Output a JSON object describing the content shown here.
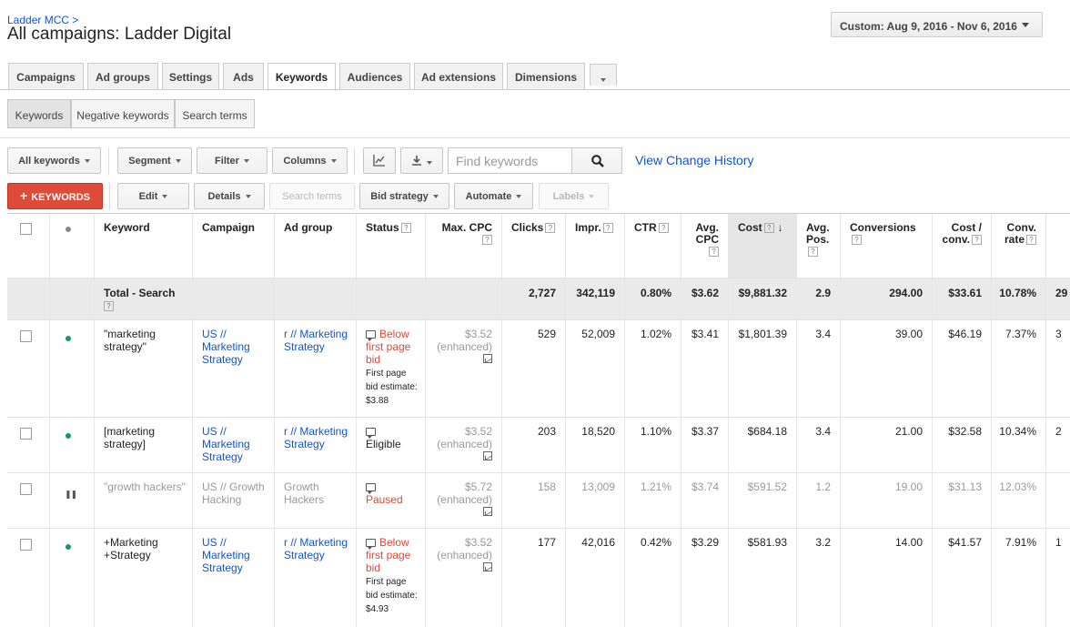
{
  "breadcrumb": "Ladder MCC >",
  "title": "All campaigns: Ladder Digital",
  "date_range": "Custom: Aug 9, 2016 - Nov 6, 2016",
  "tabs": [
    "Campaigns",
    "Ad groups",
    "Settings",
    "Ads",
    "Keywords",
    "Audiences",
    "Ad extensions",
    "Dimensions"
  ],
  "subtabs": [
    "Keywords",
    "Negative keywords",
    "Search terms"
  ],
  "toolbar": {
    "all_keywords": "All keywords",
    "segment": "Segment",
    "filter": "Filter",
    "columns": "Columns",
    "search_placeholder": "Find keywords",
    "change_history": "View Change History",
    "add_keywords": "KEYWORDS",
    "edit": "Edit",
    "details": "Details",
    "search_terms": "Search terms",
    "bid_strategy": "Bid strategy",
    "automate": "Automate",
    "labels": "Labels"
  },
  "columns": {
    "keyword": "Keyword",
    "campaign": "Campaign",
    "ad_group": "Ad group",
    "status": "Status",
    "max_cpc": "Max. CPC",
    "clicks": "Clicks",
    "impr": "Impr.",
    "ctr": "CTR",
    "avg_cpc_1": "Avg.",
    "avg_cpc_2": "CPC",
    "cost": "Cost",
    "avg_pos_1": "Avg.",
    "avg_pos_2": "Pos.",
    "conversions": "Conversions",
    "cost_conv_1": "Cost /",
    "cost_conv_2": "conv.",
    "conv_rate_1": "Conv.",
    "conv_rate_2": "rate",
    "qm": "?",
    "sort_arrow": "↓"
  },
  "total": {
    "label": "Total - Search",
    "clicks": "2,727",
    "impr": "342,119",
    "ctr": "0.80%",
    "avg_cpc": "$3.62",
    "cost": "$9,881.32",
    "avg_pos": "2.9",
    "conversions": "294.00",
    "cost_conv": "$33.61",
    "conv_rate": "10.78%",
    "extra": "29"
  },
  "rows": [
    {
      "keyword": "\"marketing strategy\"",
      "campaign": "US // Marketing Strategy",
      "ad_group": "r // Marketing Strategy",
      "status": "Below first page bid",
      "status_note": "First page bid estimate: $3.88",
      "max_cpc": "$3.52",
      "max_cpc_note": "(enhanced)",
      "clicks": "529",
      "impr": "52,009",
      "ctr": "1.02%",
      "avg_cpc": "$3.41",
      "cost": "$1,801.39",
      "avg_pos": "3.4",
      "conversions": "39.00",
      "cost_conv": "$46.19",
      "conv_rate": "7.37%",
      "extra": "3"
    },
    {
      "keyword": "[marketing strategy]",
      "campaign": "US // Marketing Strategy",
      "ad_group": "r // Marketing Strategy",
      "status": "Eligible",
      "max_cpc": "$3.52",
      "max_cpc_note": "(enhanced)",
      "clicks": "203",
      "impr": "18,520",
      "ctr": "1.10%",
      "avg_cpc": "$3.37",
      "cost": "$684.18",
      "avg_pos": "3.4",
      "conversions": "21.00",
      "cost_conv": "$32.58",
      "conv_rate": "10.34%",
      "extra": "2"
    },
    {
      "keyword": "\"growth hackers\"",
      "campaign": "US // Growth Hacking",
      "ad_group": "Growth Hackers",
      "status": "Paused",
      "max_cpc": "$5.72",
      "max_cpc_note": "(enhanced)",
      "clicks": "158",
      "impr": "13,009",
      "ctr": "1.21%",
      "avg_cpc": "$3.74",
      "cost": "$591.52",
      "avg_pos": "1.2",
      "conversions": "19.00",
      "cost_conv": "$31.13",
      "conv_rate": "12.03%",
      "extra": ""
    },
    {
      "keyword": "+Marketing +Strategy",
      "campaign": "US // Marketing Strategy",
      "ad_group": "r // Marketing Strategy",
      "status": "Below first page bid",
      "status_note": "First page bid estimate: $4.93",
      "max_cpc": "$3.52",
      "max_cpc_note": "(enhanced)",
      "clicks": "177",
      "impr": "42,016",
      "ctr": "0.42%",
      "avg_cpc": "$3.29",
      "cost": "$581.93",
      "avg_pos": "3.2",
      "conversions": "14.00",
      "cost_conv": "$41.57",
      "conv_rate": "7.91%",
      "extra": "1"
    }
  ]
}
